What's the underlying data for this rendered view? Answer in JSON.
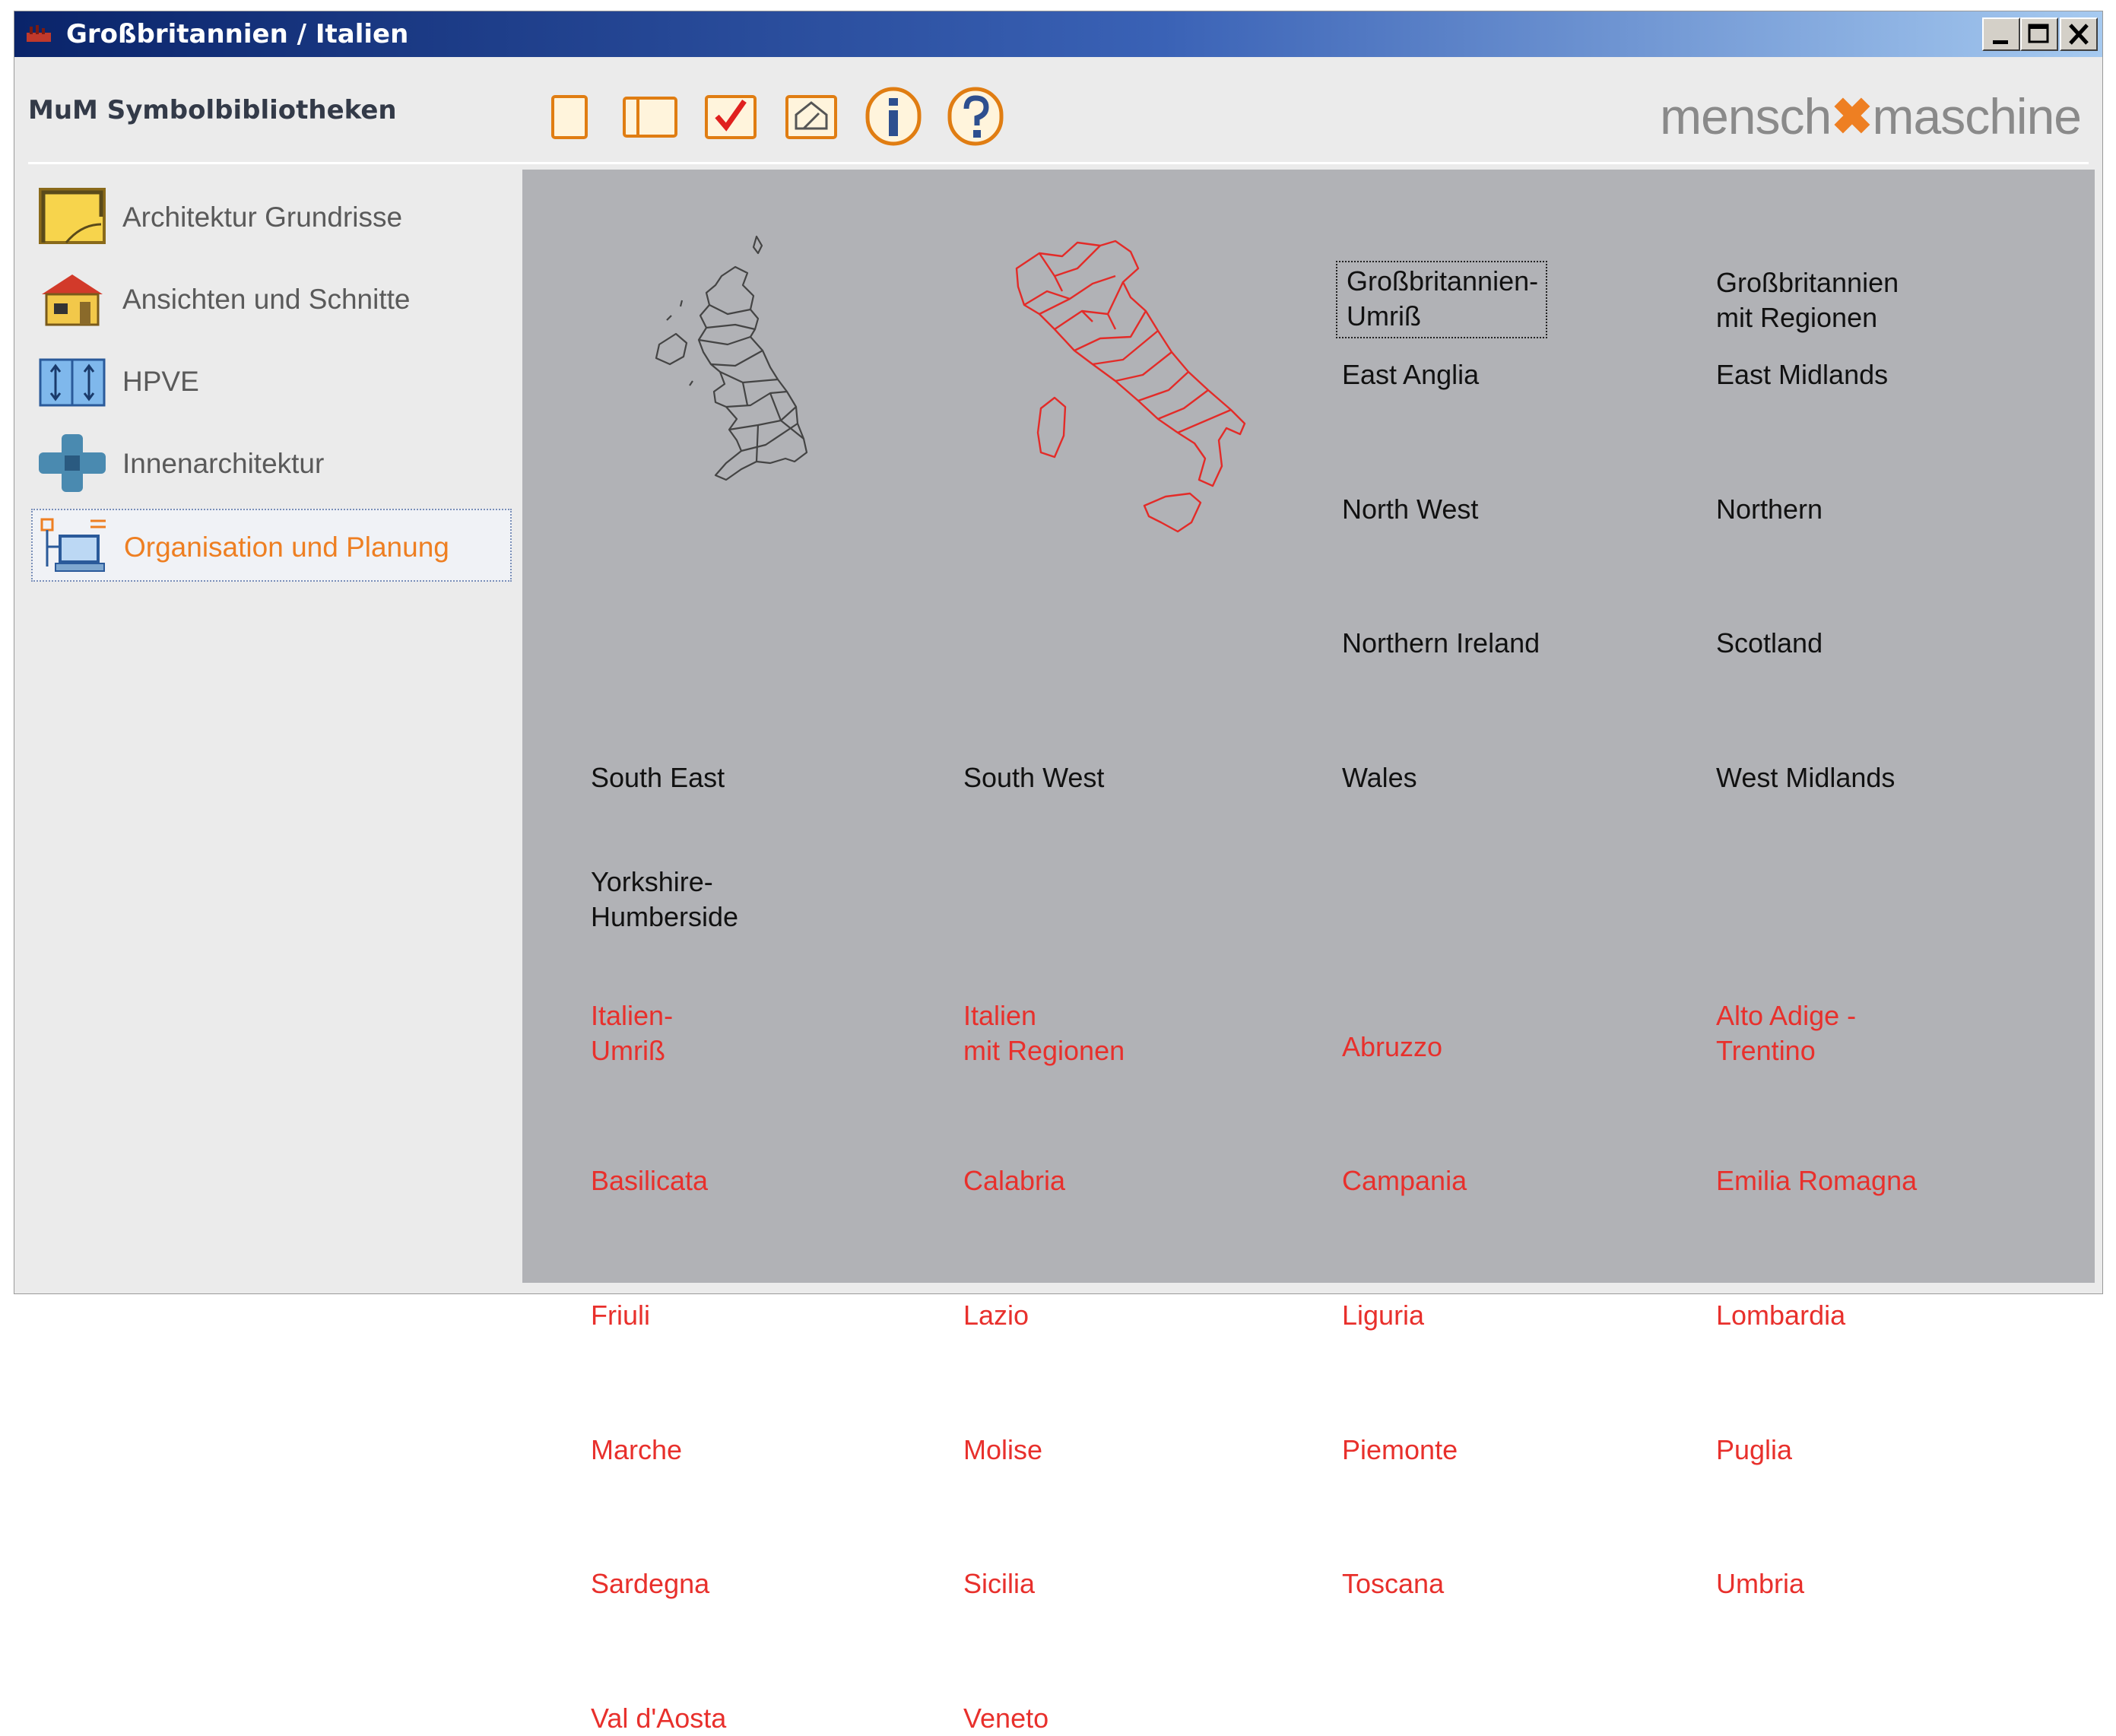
{
  "window": {
    "title": "Großbritannien / Italien"
  },
  "app": {
    "title": "MuM Symbolbibliotheken",
    "logo_left": "mensch",
    "logo_right": "maschine"
  },
  "toolbar": [
    {
      "icon": "blank-page-icon"
    },
    {
      "icon": "open-book-icon"
    },
    {
      "icon": "checkmark-icon"
    },
    {
      "icon": "house-drawing-icon"
    },
    {
      "icon": "info-icon"
    },
    {
      "icon": "help-icon"
    }
  ],
  "sidebar": {
    "items": [
      {
        "label": "Architektur Grundrisse",
        "icon": "floorplan-icon"
      },
      {
        "label": "Ansichten und Schnitte",
        "icon": "house-icon"
      },
      {
        "label": "HPVE",
        "icon": "hpve-icon"
      },
      {
        "label": "Innenarchitektur",
        "icon": "interior-icon"
      },
      {
        "label": "Organisation und Planung",
        "icon": "organisation-icon",
        "selected": true
      }
    ]
  },
  "gb": {
    "umriss": "Großbritannien-\nUmriß",
    "regionen": "Großbritannien\nmit Regionen",
    "east_anglia": "East Anglia",
    "east_midlands": "East Midlands",
    "north_west": "North West",
    "northern": "Northern",
    "northern_ireland": "Northern Ireland",
    "scotland": "Scotland",
    "south_east": "South East",
    "south_west": "South West",
    "wales": "Wales",
    "west_midlands": "West Midlands",
    "yorkshire": "Yorkshire-\nHumberside"
  },
  "it": {
    "umriss": "Italien-\nUmriß",
    "regionen": "Italien\nmit Regionen",
    "abruzzo": "Abruzzo",
    "alto_adige": "Alto Adige -\nTrentino",
    "basilicata": "Basilicata",
    "calabria": "Calabria",
    "campania": "Campania",
    "emilia": "Emilia Romagna",
    "friuli": "Friuli",
    "lazio": "Lazio",
    "liguria": "Liguria",
    "lombardia": "Lombardia",
    "marche": "Marche",
    "molise": "Molise",
    "piemonte": "Piemonte",
    "puglia": "Puglia",
    "sardegna": "Sardegna",
    "sicilia": "Sicilia",
    "toscana": "Toscana",
    "umbria": "Umbria",
    "val_daosta": "Val d'Aosta",
    "veneto": "Veneto"
  },
  "colors": {
    "gb_text": "#111111",
    "it_text": "#e8302c",
    "accent": "#ee7f22",
    "title_bar": "#0a246a",
    "content_bg": "#b1b2b6"
  }
}
